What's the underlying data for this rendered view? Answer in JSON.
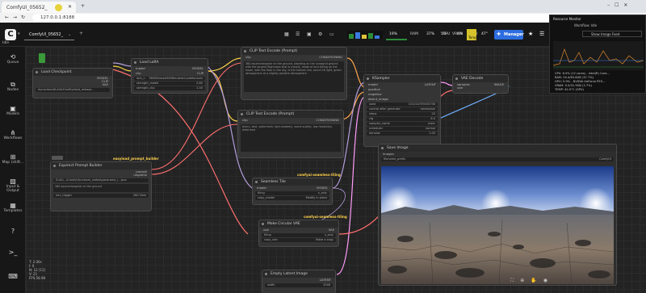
{
  "browser": {
    "tab_title": "ComfyUI_05652_",
    "url": "127.0.0.1:8188"
  },
  "app": {
    "workflow_tab": "ComfyUI_05652_",
    "status": "Idle",
    "manager_label": "Manager"
  },
  "resources": {
    "ram": "RAM",
    "ram_pct": "19%",
    "cpu": "CPU",
    "cpu_pct": "37%",
    "gpu": "GPU",
    "gpu_pct": "6%",
    "vram": "VRAM",
    "vram_pct": "5%",
    "temp": "Temp",
    "temp_val": "47°"
  },
  "sidebar": [
    {
      "label": "Queue",
      "icon": "history-icon"
    },
    {
      "label": "Nodes",
      "icon": "node-icon"
    },
    {
      "label": "Models",
      "icon": "cube-icon"
    },
    {
      "label": "Workflows",
      "icon": "sitemap-icon"
    },
    {
      "label": "Map (shift...",
      "icon": "map-icon"
    },
    {
      "label": "Input & Output",
      "icon": "image-icon"
    },
    {
      "label": "Templates",
      "icon": "grid-icon"
    }
  ],
  "monitor": {
    "title": "Resource Monitor",
    "workflow": "Workflow: Idle",
    "show_image_feed": "Show Image Feed",
    "lines": [
      "CPU: 6.9% (12 cores) - Intel(R) Core...",
      "RAM: 24.4/63.6GB (37.7%)",
      "GPU: 5.9% - NVIDIA GeForce RTX...",
      "VRAM: 0.9/31.9GB (2.7%)",
      "TEMP: 42.0°C (GPU)"
    ]
  },
  "nodes": {
    "load_checkpoint": {
      "title": "Load Checkpoint",
      "out": [
        "MODEL",
        "CLIP",
        "VAE"
      ],
      "ckpt": "dynavisionXLAllInOneStylized_release..."
    },
    "load_lora": {
      "title": "Load LoRA",
      "in": [
        "model",
        "clip"
      ],
      "out": [
        "MODEL",
        "CLIP"
      ],
      "lora_label": "lora_n",
      "lora": "360\\Relaxed360Rendered.safetensors",
      "sm_label": "strength_model",
      "sm": "0.85",
      "sc_label": "strength_clip",
      "sc": "1.00"
    },
    "clip_pos": {
      "title": "CLIP Text Encode (Prompt)",
      "in": "clip",
      "out": "CONDITIONING",
      "text": "360 equirectangular on the ground, standing on the lunargrid ground with the largest Highmoon that is closely, made of and sitting on the moon, with the floor in the sky, is the horizon line, round 16 light, green atmospheric at a slightly positive atmosphere"
    },
    "clip_neg": {
      "title": "CLIP Text Encode (Prompt)",
      "in": "clip",
      "out": "CONDITIONING",
      "text": "blurry, text, watermark, bad anatomy, worst quality, low resolution, deformed"
    },
    "ksampler": {
      "title": "KSampler",
      "in": [
        "model",
        "positive",
        "negative",
        "latent_image"
      ],
      "out": "LATENT",
      "w": [
        [
          "seed",
          "101204759030756"
        ],
        [
          "control after generate",
          "randomize"
        ],
        [
          "steps",
          "20"
        ],
        [
          "cfg",
          "8.0"
        ],
        [
          "sampler_name",
          "euler"
        ],
        [
          "scheduler",
          "normal"
        ],
        [
          "denoise",
          "1.00"
        ]
      ]
    },
    "vae_decode": {
      "title": "VAE Decode",
      "in": [
        "samples",
        "vae"
      ],
      "out": "IMAGE"
    },
    "save_image": {
      "title": "Save Image",
      "in": "images",
      "prefix_label": "filename_prefix",
      "prefix": "ComfyUI"
    },
    "prompt_builder": {
      "group": "easyload_prompt_builder",
      "title": "Equirect Prompt Builder",
      "out": [
        "prompt",
        "negative"
      ],
      "path": "D:\\AI\\...\\ComfyUI\\custom_nodes\\panorama_\\...json",
      "text": "360 equirectangular on the ground",
      "sub": "280 View",
      "sub_label": "mix_trigger"
    },
    "seamless_tile": {
      "group": "comfyui-seamless-tiling",
      "title": "Seamless Tile",
      "in": "model",
      "out": "MODEL",
      "w": [
        [
          "tiling",
          "x_only"
        ],
        [
          "copy_model",
          "Modify in place"
        ]
      ]
    },
    "circular_vae": {
      "group": "comfyui-seamless-tiling",
      "title": "Make Circular VAE",
      "in": "vae",
      "out": "VAE",
      "w": [
        [
          "tiling",
          "x_only"
        ],
        [
          "copy_vae",
          "Make a copy"
        ]
      ]
    },
    "empty_latent": {
      "title": "Empty Latent Image",
      "out": "LATENT",
      "w": [
        [
          "width",
          "2048"
        ]
      ]
    }
  },
  "status_lines": [
    "T: 2.00s",
    "I: 0",
    "N: 12 [11]",
    "V: 21",
    "FPS:58.98"
  ],
  "colors": {
    "clip": "#ffd24d",
    "model": "#b39ddb",
    "vae": "#ff6f6f",
    "cond": "#ffa64d",
    "latent": "#ff9cf9",
    "image": "#6fb0ff"
  }
}
